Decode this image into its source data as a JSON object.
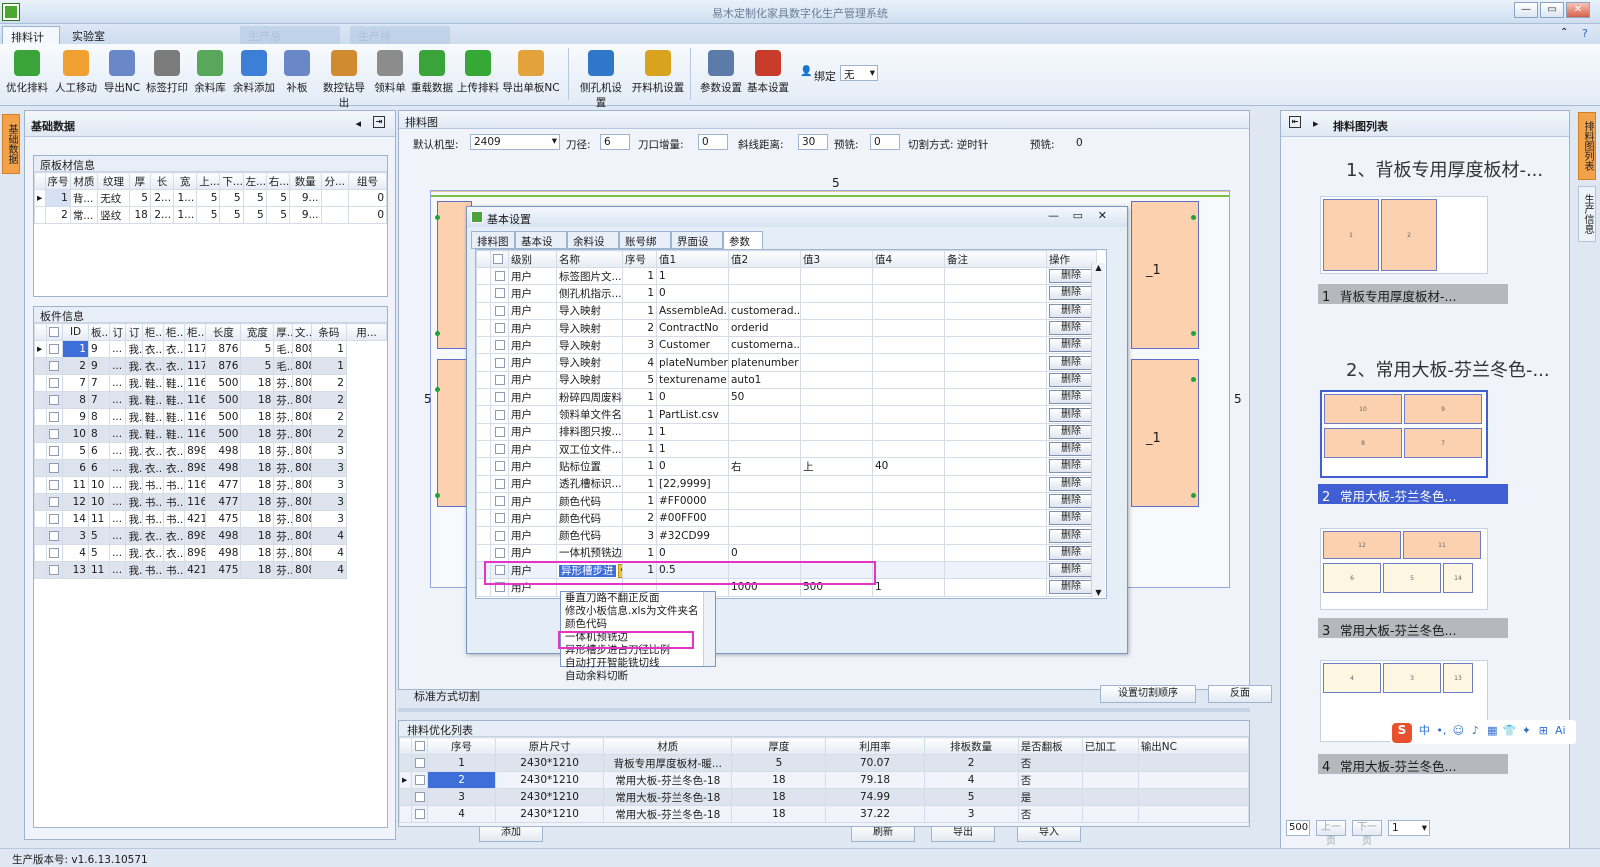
{
  "window": {
    "title": "易木定制化家具数字化生产管理系统",
    "ghost_tabs": [
      "生产总",
      "生产排"
    ]
  },
  "ribbon_tabs": [
    {
      "label": "排料计算",
      "active": true
    },
    {
      "label": "实验室",
      "active": false
    }
  ],
  "toolbar": [
    {
      "label": "优化排料",
      "icon": "layout-icon",
      "color": "#3aa33a"
    },
    {
      "label": "人工移动",
      "icon": "move-icon",
      "color": "#f0a030"
    },
    {
      "label": "导出NC",
      "icon": "export-nc-icon",
      "color": "#6a87c8"
    },
    {
      "label": "标签打印",
      "icon": "printer-icon",
      "color": "#7b7b7b"
    },
    {
      "label": "余料库",
      "icon": "offcut-library-icon",
      "color": "#58a75a"
    },
    {
      "label": "余料添加",
      "icon": "add-offcut-icon",
      "color": "#3b7fd6"
    },
    {
      "label": "补板",
      "icon": "patch-board-icon",
      "color": "#6a87c8"
    },
    {
      "label": "数控钻导出",
      "icon": "cnc-drill-icon",
      "color": "#d08a30"
    },
    {
      "label": "领料单",
      "icon": "material-list-icon",
      "color": "#8c8c8c"
    },
    {
      "label": "重载数据",
      "icon": "reload-icon",
      "color": "#3aa33a"
    },
    {
      "label": "上传排料",
      "icon": "upload-icon",
      "color": "#36a836"
    },
    {
      "label": "导出单板NC",
      "icon": "export-board-nc-icon",
      "color": "#e3a23b"
    },
    {
      "label": "侧孔机设置",
      "icon": "side-drill-icon",
      "color": "#2f78c9"
    },
    {
      "label": "开料机设置",
      "icon": "cutter-settings-icon",
      "color": "#d9a320"
    },
    {
      "label": "参数设置",
      "icon": "params-icon",
      "color": "#5d7ba8"
    },
    {
      "label": "基本设置",
      "icon": "tools-icon",
      "color": "#c83a2a"
    }
  ],
  "bind": {
    "label": "绑定",
    "value": "无"
  },
  "left_strip": {
    "tab1": "基础数据",
    "tab2": "排料图列表",
    "tab3": "生产信息"
  },
  "basic_panel": {
    "title": "基础数据"
  },
  "raw_material": {
    "label": "原板材信息",
    "headers": [
      "序号",
      "材质",
      "纹理",
      "厚",
      "长",
      "宽",
      "上...",
      "下...",
      "左...",
      "右...",
      "数量",
      "分...",
      "组号"
    ],
    "rows": [
      [
        "1",
        "背...",
        "无纹",
        "5",
        "2...",
        "1...",
        "5",
        "5",
        "5",
        "5",
        "9...",
        "",
        "0"
      ],
      [
        "2",
        "常...",
        "竖纹",
        "18",
        "2...",
        "1...",
        "5",
        "5",
        "5",
        "5",
        "9...",
        "",
        "0"
      ]
    ]
  },
  "parts": {
    "label": "板件信息",
    "headers": [
      "",
      "ID",
      "板...",
      "订",
      "订",
      "柜...",
      "柜...",
      "柜...",
      "长度",
      "宽度",
      "厚...",
      "文...",
      "条码",
      "用..."
    ],
    "rows": [
      [
        "1",
        "9",
        "...",
        "我...",
        "衣...",
        "衣...",
        "1176",
        "876",
        "5",
        "毛...",
        "808...",
        "1"
      ],
      [
        "2",
        "9",
        "...",
        "我...",
        "衣...",
        "衣...",
        "1176",
        "876",
        "5",
        "毛...",
        "808...",
        "1"
      ],
      [
        "7",
        "7",
        "...",
        "我...",
        "鞋...",
        "鞋...",
        "1164",
        "500",
        "18",
        "芬...",
        "808...",
        "2"
      ],
      [
        "8",
        "7",
        "...",
        "我...",
        "鞋...",
        "鞋...",
        "1164",
        "500",
        "18",
        "芬...",
        "808...",
        "2"
      ],
      [
        "9",
        "8",
        "...",
        "我...",
        "鞋...",
        "鞋...",
        "1164",
        "500",
        "18",
        "芬...",
        "808...",
        "2"
      ],
      [
        "10",
        "8",
        "...",
        "我...",
        "鞋...",
        "鞋...",
        "1164",
        "500",
        "18",
        "芬...",
        "808...",
        "2"
      ],
      [
        "5",
        "6",
        "...",
        "我...",
        "衣...",
        "衣...",
        "898",
        "498",
        "18",
        "芬...",
        "808...",
        "3"
      ],
      [
        "6",
        "6",
        "...",
        "我...",
        "衣...",
        "衣...",
        "898",
        "498",
        "18",
        "芬...",
        "808...",
        "3"
      ],
      [
        "11",
        "10",
        "...",
        "我...",
        "书...",
        "书...",
        "1164",
        "477",
        "18",
        "芬...",
        "808...",
        "3"
      ],
      [
        "12",
        "10",
        "...",
        "我...",
        "书...",
        "书...",
        "1164",
        "477",
        "18",
        "芬...",
        "808...",
        "3"
      ],
      [
        "14",
        "11",
        "...",
        "我...",
        "书...",
        "书...",
        "421",
        "475",
        "18",
        "芬...",
        "808...",
        "3"
      ],
      [
        "3",
        "5",
        "...",
        "我...",
        "衣...",
        "衣...",
        "898",
        "498",
        "18",
        "芬...",
        "808...",
        "4"
      ],
      [
        "4",
        "5",
        "...",
        "我...",
        "衣...",
        "衣...",
        "898",
        "498",
        "18",
        "芬...",
        "808...",
        "4"
      ],
      [
        "13",
        "11",
        "...",
        "我...",
        "书...",
        "书...",
        "421",
        "475",
        "18",
        "芬...",
        "808...",
        "4"
      ]
    ]
  },
  "layout_panel": {
    "title": "排料图",
    "machine_label": "默认机型:",
    "machine": "2409",
    "knife_label": "刀径:",
    "knife": "6",
    "inc_label": "刀口增量:",
    "inc": "0",
    "bevel_label": "斜线距离:",
    "bevel": "30",
    "milling_label": "预铣:",
    "milling": "0",
    "cut_mode": "切割方式: 逆时针",
    "pre_label": "预铣:",
    "pre": "0",
    "dim_top": "5",
    "dim_left": "5",
    "dim_right": "5",
    "dim_mid": "5",
    "seg1": "_1",
    "seg2": "_1",
    "mode_text": "标准方式切割",
    "order_btn": "设置切割顺序",
    "flip_btn": "反面"
  },
  "dialog": {
    "title": "基本设置",
    "tabs": [
      "排料图",
      "基本设置",
      "余料设置",
      "账号绑定",
      "界面设置",
      "参数表"
    ],
    "headers": [
      "",
      "级别",
      "名称",
      "序号",
      "值1",
      "值2",
      "值3",
      "值4",
      "备注",
      "操作"
    ],
    "delete_label": "删除",
    "rows": [
      [
        "用户",
        "标签图片文...",
        "1",
        "1",
        "",
        "",
        "",
        ""
      ],
      [
        "用户",
        "侧孔机指示...",
        "1",
        "0",
        "",
        "",
        "",
        ""
      ],
      [
        "用户",
        "导入映射",
        "1",
        "AssembleAd...",
        "customerad...",
        "",
        "",
        ""
      ],
      [
        "用户",
        "导入映射",
        "2",
        "ContractNo",
        "orderid",
        "",
        "",
        ""
      ],
      [
        "用户",
        "导入映射",
        "3",
        "Customer",
        "customerna...",
        "",
        "",
        ""
      ],
      [
        "用户",
        "导入映射",
        "4",
        "plateNumber",
        "platenumber",
        "",
        "",
        ""
      ],
      [
        "用户",
        "导入映射",
        "5",
        "texturename",
        "auto1",
        "",
        "",
        ""
      ],
      [
        "用户",
        "粉碎四周废料",
        "1",
        "0",
        "50",
        "",
        "",
        ""
      ],
      [
        "用户",
        "领料单文件名",
        "1",
        "PartList.csv",
        "",
        "",
        "",
        ""
      ],
      [
        "用户",
        "排料图只按...",
        "1",
        "1",
        "",
        "",
        "",
        ""
      ],
      [
        "用户",
        "双工位文件...",
        "1",
        "1",
        "",
        "",
        "",
        ""
      ],
      [
        "用户",
        "贴标位置",
        "1",
        "0",
        "右",
        "上",
        "40",
        ""
      ],
      [
        "用户",
        "透孔槽标识...",
        "1",
        "[22,9999]",
        "",
        "",
        "",
        ""
      ],
      [
        "用户",
        "颜色代码",
        "1",
        "#FF0000",
        "",
        "",
        "",
        ""
      ],
      [
        "用户",
        "颜色代码",
        "2",
        "#00FF00",
        "",
        "",
        "",
        ""
      ],
      [
        "用户",
        "颜色代码",
        "3",
        "#32CD99",
        "",
        "",
        "",
        ""
      ],
      [
        "用户",
        "一体机预铣边",
        "1",
        "0",
        "0",
        "",
        "",
        ""
      ],
      [
        "用户",
        "异形槽步进",
        "1",
        "0.5",
        "",
        "",
        "",
        ""
      ],
      [
        "用户",
        "",
        "",
        "",
        "1000",
        "500",
        "1",
        ""
      ]
    ],
    "add_btn": "添加",
    "refresh_btn": "刷新",
    "export_btn": "导出",
    "import_btn": "导入",
    "dropdown": [
      "垂直刀路不翻正反面",
      "修改小板信息.xls为文件夹名",
      "颜色代码",
      "一体机预铣边",
      "异形槽步进占刀径比例",
      "自动打开智能铣切线",
      "自动余料切断"
    ]
  },
  "optimize_list": {
    "title": "排料优化列表",
    "headers": [
      "",
      "序号",
      "原片尺寸",
      "材质",
      "厚度",
      "利用率",
      "排板数量",
      "是否翻板",
      "已加工",
      "输出NC"
    ],
    "rows": [
      [
        "1",
        "2430*1210",
        "背板专用厚度板材-暖...",
        "5",
        "70.07",
        "2",
        "否",
        "",
        ""
      ],
      [
        "2",
        "2430*1210",
        "常用大板-芬兰冬色-18",
        "18",
        "79.18",
        "4",
        "否",
        "",
        ""
      ],
      [
        "3",
        "2430*1210",
        "常用大板-芬兰冬色-18",
        "18",
        "74.99",
        "5",
        "是",
        "",
        ""
      ],
      [
        "4",
        "2430*1210",
        "常用大板-芬兰冬色-18",
        "18",
        "37.22",
        "3",
        "否",
        "",
        ""
      ]
    ]
  },
  "sheet_list": {
    "title": "排料图列表",
    "group1": "1、背板专用厚度板材-...",
    "group2": "2、常用大板-芬兰冬色-...",
    "caps": [
      "背板专用厚度板材-...",
      "常用大板-芬兰冬色...",
      "常用大板-芬兰冬色...",
      "常用大板-芬兰冬色..."
    ],
    "nums": [
      "1",
      "2",
      "3",
      "4"
    ],
    "labels1": [
      "1",
      "2"
    ],
    "labels2": [
      "10",
      "9",
      "8",
      "7"
    ],
    "labels3": [
      "12",
      "11",
      "6",
      "5",
      "14"
    ],
    "labels4": [
      "4",
      "3",
      "13"
    ],
    "page_size": "500",
    "prev": "上一页",
    "next": "下一页",
    "page": "1"
  },
  "ime": {
    "brand": "S",
    "items": [
      "中",
      "•,",
      "☺",
      "♪",
      "▦",
      "👕",
      "✦",
      "⊞",
      "Ai"
    ]
  },
  "status": {
    "version": "生产版本号:  v1.6.13.10571"
  }
}
